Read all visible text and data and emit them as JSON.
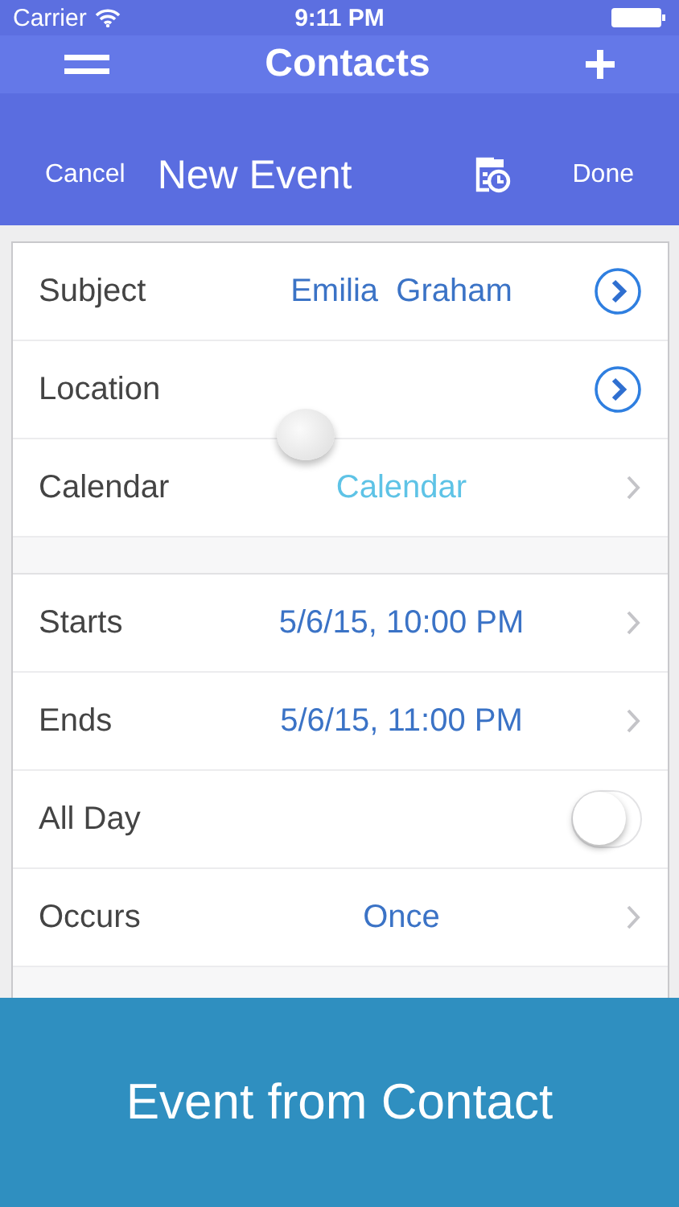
{
  "status_bar": {
    "carrier": "Carrier",
    "time": "9:11 PM"
  },
  "top_bar": {
    "title": "Contacts"
  },
  "event_bar": {
    "cancel": "Cancel",
    "title": "New Event",
    "done": "Done"
  },
  "sections": [
    {
      "rows": [
        {
          "label": "Subject",
          "value": "Emilia  Graham",
          "kind": "link",
          "color": "#3b73c6"
        },
        {
          "label": "Location",
          "kind": "link"
        },
        {
          "label": "Calendar",
          "value": "Calendar",
          "kind": "chevron",
          "color": "#5ec3e6"
        }
      ]
    },
    {
      "rows": [
        {
          "label": "Starts",
          "value": "5/6/15, 10:00 PM",
          "kind": "chevron",
          "color": "#3b73c6"
        },
        {
          "label": "Ends",
          "value": "5/6/15, 11:00 PM",
          "kind": "chevron",
          "color": "#3b73c6"
        },
        {
          "label": "All Day",
          "kind": "toggle",
          "on": false
        },
        {
          "label": "Occurs",
          "value": "Once",
          "kind": "chevron",
          "color": "#3b73c6"
        }
      ]
    }
  ],
  "banner": {
    "text": "Event from Contact"
  }
}
